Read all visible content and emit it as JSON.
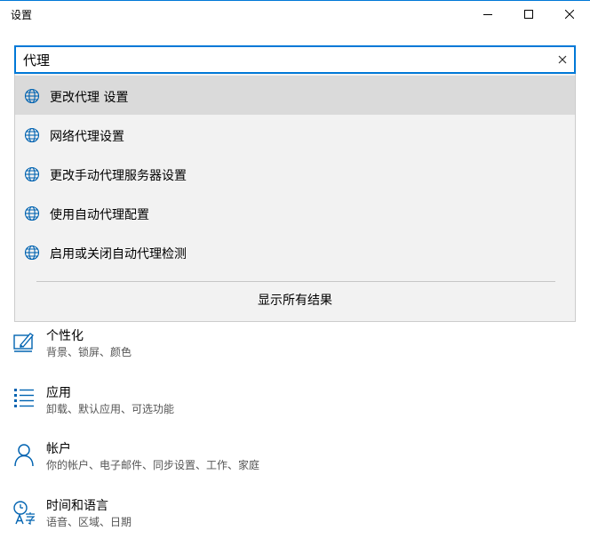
{
  "window": {
    "title": "设置",
    "accent": "#0078d7"
  },
  "search": {
    "value": "代理",
    "clear_icon": "close-icon"
  },
  "suggestions": [
    {
      "label": "更改代理 设置",
      "icon": "globe-icon",
      "active": true
    },
    {
      "label": "网络代理设置",
      "icon": "globe-icon"
    },
    {
      "label": "更改手动代理服务器设置",
      "icon": "globe-icon"
    },
    {
      "label": "使用自动代理配置",
      "icon": "globe-icon"
    },
    {
      "label": "启用或关闭自动代理检测",
      "icon": "globe-icon"
    }
  ],
  "show_all": "显示所有结果",
  "categories": [
    {
      "name": "个性化",
      "desc": "背景、锁屏、颜色",
      "icon": "personalization-icon"
    },
    {
      "name": "应用",
      "desc": "卸载、默认应用、可选功能",
      "icon": "apps-icon"
    },
    {
      "name": "帐户",
      "desc": "你的帐户、电子邮件、同步设置、工作、家庭",
      "icon": "account-icon"
    },
    {
      "name": "时间和语言",
      "desc": "语音、区域、日期",
      "icon": "time-language-icon"
    }
  ]
}
